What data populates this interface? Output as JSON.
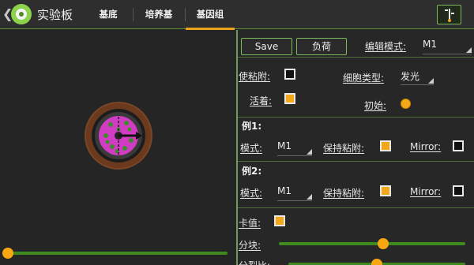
{
  "header": {
    "back_icon": "chevron-left-icon",
    "app_title": "实验板",
    "tabs": [
      {
        "label": "基底",
        "active": false
      },
      {
        "label": "培养基",
        "active": false
      },
      {
        "label": "基因组",
        "active": true
      }
    ],
    "accent_color": "#e8a21c",
    "brand_color": "#8cd24a"
  },
  "panel": {
    "save_label": "Save",
    "load_label": "负荷",
    "edit_mode_label": "编辑模式:",
    "edit_mode_value": "M1",
    "sticky_label": "使粘附:",
    "sticky_checked": false,
    "cell_type_label": "细胞类型:",
    "cell_type_value": "发光",
    "active_label": "活着:",
    "active_checked": true,
    "initial_label": "初始:",
    "initial_selected": true,
    "child1": {
      "title": "例1:",
      "mode_label": "模式:",
      "mode_value": "M1",
      "keep_sticky_label": "保持粘附:",
      "keep_sticky_checked": true,
      "mirror_label": "Mirror:",
      "mirror_checked": false
    },
    "child2": {
      "title": "例2:",
      "mode_label": "模式:",
      "mode_value": "M1",
      "keep_sticky_label": "保持粘附:",
      "keep_sticky_checked": true,
      "mirror_label": "Mirror:",
      "mirror_checked": false
    },
    "calorie_label": "卡值:",
    "calorie_checked": true,
    "split_label": "分块:",
    "split_value": 0.56,
    "split_ratio_label": "分裂比:",
    "split_ratio_value": 0.5
  },
  "canvas": {
    "zoom_slider_value": 0.0
  }
}
